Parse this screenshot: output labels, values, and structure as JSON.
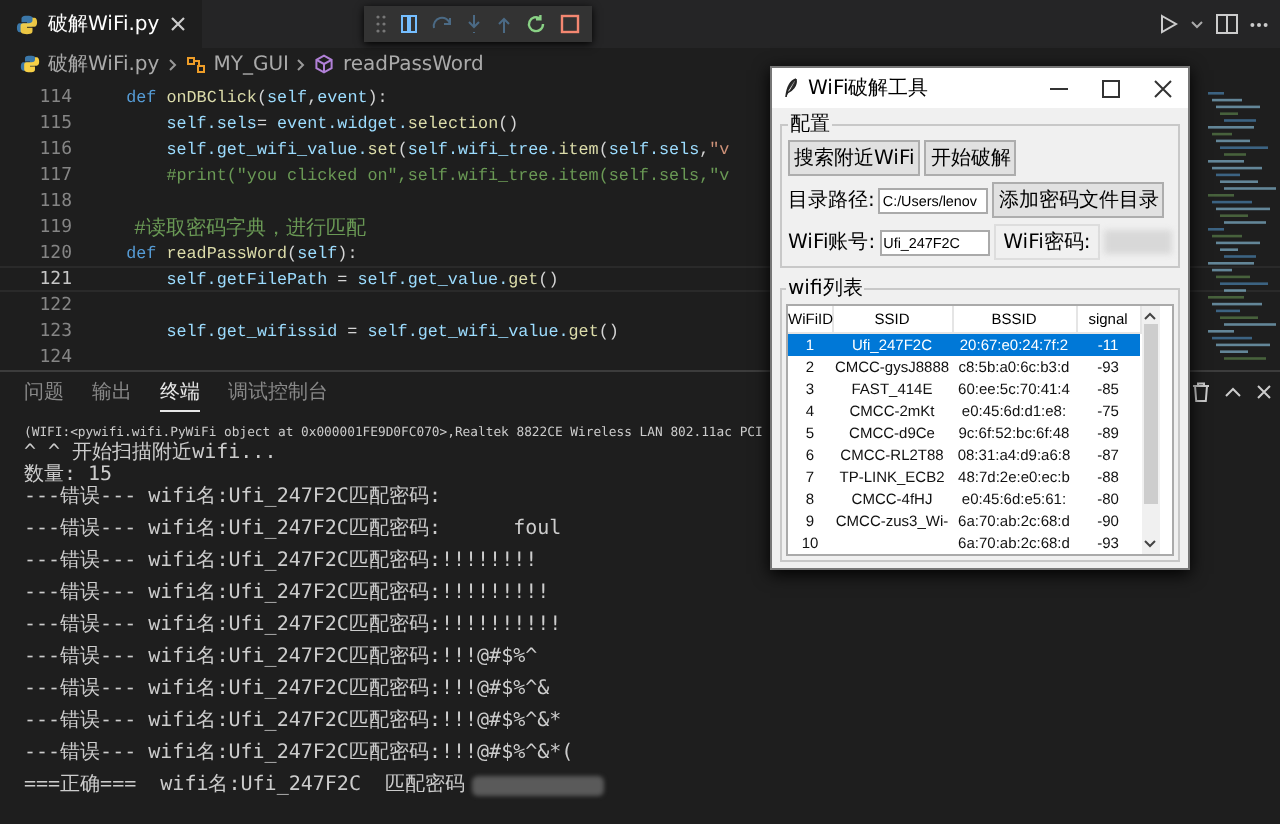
{
  "editor_tabs": [
    {
      "label": "破解WiFi.py",
      "selected": true
    }
  ],
  "breadcrumbs": [
    {
      "label": "破解WiFi.py",
      "kind": "file"
    },
    {
      "label": "MY_GUI",
      "kind": "class"
    },
    {
      "label": "readPassWord",
      "kind": "method"
    }
  ],
  "code_lines": [
    {
      "number": "114",
      "current": false,
      "tokens": [
        {
          "text": "    def ",
          "kind": "keyword"
        },
        {
          "text": "onDBClick",
          "kind": "function"
        },
        {
          "text": "(",
          "kind": "plain"
        },
        {
          "text": "self",
          "kind": "variable"
        },
        {
          "text": ",",
          "kind": "plain"
        },
        {
          "text": "event",
          "kind": "variable"
        },
        {
          "text": "):",
          "kind": "plain"
        }
      ]
    },
    {
      "number": "115",
      "current": false,
      "tokens": [
        {
          "text": "        self.sels",
          "kind": "variable"
        },
        {
          "text": "= ",
          "kind": "plain"
        },
        {
          "text": "event.widget.",
          "kind": "variable"
        },
        {
          "text": "selection",
          "kind": "function"
        },
        {
          "text": "()",
          "kind": "plain"
        }
      ]
    },
    {
      "number": "116",
      "current": false,
      "tokens": [
        {
          "text": "        self.get_wifi_value.",
          "kind": "variable"
        },
        {
          "text": "set",
          "kind": "function"
        },
        {
          "text": "(",
          "kind": "plain"
        },
        {
          "text": "self.wifi_tree.",
          "kind": "variable"
        },
        {
          "text": "item",
          "kind": "function"
        },
        {
          "text": "(",
          "kind": "plain"
        },
        {
          "text": "self.sels",
          "kind": "variable"
        },
        {
          "text": ",",
          "kind": "plain"
        },
        {
          "text": "\"v",
          "kind": "string"
        }
      ]
    },
    {
      "number": "117",
      "current": false,
      "tokens": [
        {
          "text": "        #print(\"you clicked on\",self.wifi_tree.item(self.sels,\"v",
          "kind": "comment"
        }
      ]
    },
    {
      "number": "118",
      "current": false
    },
    {
      "number": "119",
      "current": false,
      "tokens": [
        {
          "text": "    #读取密码字典，进行匹配",
          "kind": "comment"
        }
      ]
    },
    {
      "number": "120",
      "current": false,
      "tokens": [
        {
          "text": "    def ",
          "kind": "keyword"
        },
        {
          "text": "readPassWord",
          "kind": "function"
        },
        {
          "text": "(",
          "kind": "plain"
        },
        {
          "text": "self",
          "kind": "variable"
        },
        {
          "text": "):",
          "kind": "plain"
        }
      ]
    },
    {
      "number": "121",
      "current": true,
      "tokens": [
        {
          "text": "        self.getFilePath",
          "kind": "variable"
        },
        {
          "text": " = ",
          "kind": "plain"
        },
        {
          "text": "self.get_value.",
          "kind": "variable"
        },
        {
          "text": "get",
          "kind": "function"
        },
        {
          "text": "()",
          "kind": "plain"
        }
      ]
    },
    {
      "number": "122",
      "current": false
    },
    {
      "number": "123",
      "current": false,
      "tokens": [
        {
          "text": "        self.get_wifissid",
          "kind": "variable"
        },
        {
          "text": " = ",
          "kind": "plain"
        },
        {
          "text": "self.get_wifi_value.",
          "kind": "variable"
        },
        {
          "text": "get",
          "kind": "function"
        },
        {
          "text": "()",
          "kind": "plain"
        }
      ]
    },
    {
      "number": "124",
      "current": false
    }
  ],
  "panel": {
    "tabs": [
      {
        "label": "问题",
        "selected": false
      },
      {
        "label": "输出",
        "selected": false
      },
      {
        "label": "终端",
        "selected": true
      },
      {
        "label": "调试控制台",
        "selected": false
      }
    ],
    "terminal_lines": [
      {
        "text": "(WIFI:<pywifi.wifi.PyWiFi object at 0x000001FE9D0FC070>,Realtek 8822CE Wireless LAN 802.11ac PCI",
        "kind": "info",
        "redacted": false
      },
      {
        "text": "^ ^ 开始扫描附近wifi...",
        "kind": "info",
        "redacted": false
      },
      {
        "text": "数量: 15",
        "kind": "info",
        "redacted": false
      },
      {
        "text": "---错误--- wifi名:Ufi_247F2C匹配密码:",
        "kind": "attempt",
        "redacted": false
      },
      {
        "text": "---错误--- wifi名:Ufi_247F2C匹配密码:      foul",
        "kind": "attempt",
        "redacted": false
      },
      {
        "text": "---错误--- wifi名:Ufi_247F2C匹配密码:!!!!!!!!",
        "kind": "attempt",
        "redacted": false
      },
      {
        "text": "---错误--- wifi名:Ufi_247F2C匹配密码:!!!!!!!!!",
        "kind": "attempt",
        "redacted": false
      },
      {
        "text": "---错误--- wifi名:Ufi_247F2C匹配密码:!!!!!!!!!!",
        "kind": "attempt",
        "redacted": false
      },
      {
        "text": "---错误--- wifi名:Ufi_247F2C匹配密码:!!!@#$%^",
        "kind": "attempt",
        "redacted": false
      },
      {
        "text": "---错误--- wifi名:Ufi_247F2C匹配密码:!!!@#$%^&",
        "kind": "attempt",
        "redacted": false
      },
      {
        "text": "---错误--- wifi名:Ufi_247F2C匹配密码:!!!@#$%^&*",
        "kind": "attempt",
        "redacted": false
      },
      {
        "text": "---错误--- wifi名:Ufi_247F2C匹配密码:!!!@#$%^&*(",
        "kind": "attempt",
        "redacted": false
      },
      {
        "text": "===正确===  wifi名:Ufi_247F2C  匹配密码",
        "kind": "attempt",
        "redacted": true
      }
    ]
  },
  "tk_window": {
    "title": "WiFi破解工具",
    "config_group": {
      "label": "配置",
      "search_button": "搜索附近WiFi",
      "crack_button": "开始破解",
      "path_label": "目录路径:",
      "path_value": "C:/Users/lenov",
      "add_dir_button": "添加密码文件目录",
      "account_label": "WiFi账号:",
      "account_value": "Ufi_247F2C",
      "password_label": "WiFi密码:"
    },
    "list_group": {
      "label": "wifi列表",
      "columns": [
        "WiFiID",
        "SSID",
        "BSSID",
        "signal"
      ],
      "rows": [
        {
          "id": "1",
          "ssid": "Ufi_247F2C",
          "bssid": "20:67:e0:24:7f:2",
          "signal": "-11",
          "selected": true
        },
        {
          "id": "2",
          "ssid": "CMCC-gysJ8888",
          "bssid": "c8:5b:a0:6c:b3:d",
          "signal": "-93",
          "selected": false
        },
        {
          "id": "3",
          "ssid": "FAST_414E",
          "bssid": "60:ee:5c:70:41:4",
          "signal": "-85",
          "selected": false
        },
        {
          "id": "4",
          "ssid": "CMCC-2mKt",
          "bssid": "e0:45:6d:d1:e8:",
          "signal": "-75",
          "selected": false
        },
        {
          "id": "5",
          "ssid": "CMCC-d9Ce",
          "bssid": "9c:6f:52:bc:6f:48",
          "signal": "-89",
          "selected": false
        },
        {
          "id": "6",
          "ssid": "CMCC-RL2T88",
          "bssid": "08:31:a4:d9:a6:8",
          "signal": "-87",
          "selected": false
        },
        {
          "id": "7",
          "ssid": "TP-LINK_ECB2",
          "bssid": "48:7d:2e:e0:ec:b",
          "signal": "-88",
          "selected": false
        },
        {
          "id": "8",
          "ssid": "CMCC-4fHJ",
          "bssid": "e0:45:6d:e5:61:",
          "signal": "-80",
          "selected": false
        },
        {
          "id": "9",
          "ssid": "CMCC-zus3_Wi-",
          "bssid": "6a:70:ab:2c:68:d",
          "signal": "-90",
          "selected": false
        },
        {
          "id": "10",
          "bssid": "6a:70:ab:2c:68:d",
          "signal": "-93",
          "selected": false
        }
      ]
    }
  }
}
